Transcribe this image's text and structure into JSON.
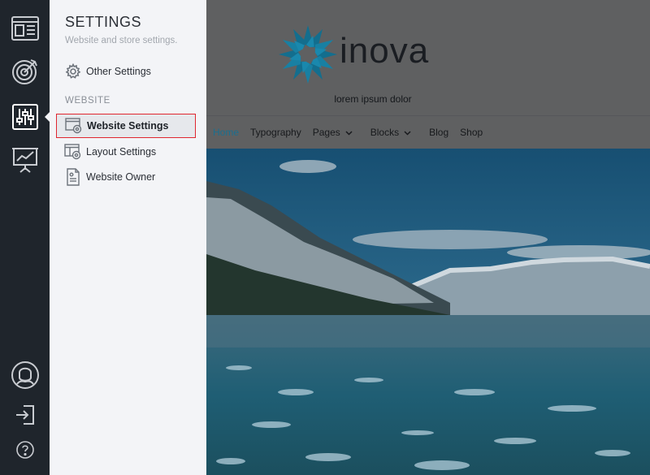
{
  "rail": {
    "items": [
      {
        "icon": "layout-icon"
      },
      {
        "icon": "target-icon"
      },
      {
        "icon": "sliders-icon",
        "active": true
      },
      {
        "icon": "presentation-chart-icon"
      },
      {
        "icon": "user-avatar-icon"
      },
      {
        "icon": "sign-in-icon"
      },
      {
        "icon": "help-icon"
      }
    ]
  },
  "panel": {
    "title": "SETTINGS",
    "subtitle": "Website and store settings.",
    "other_settings_label": "Other Settings",
    "section_heading": "WEBSITE",
    "items": [
      {
        "label": "Website Settings",
        "icon": "website-settings-icon",
        "selected": true
      },
      {
        "label": "Layout Settings",
        "icon": "layout-settings-icon"
      },
      {
        "label": "Website Owner",
        "icon": "document-icon"
      }
    ]
  },
  "site": {
    "logo_text": "inova",
    "tagline": "lorem ipsum dolor",
    "nav": [
      {
        "label": "Home",
        "active": true
      },
      {
        "label": "Typography"
      },
      {
        "label": "Pages",
        "dropdown": true
      },
      {
        "label": "Blocks",
        "dropdown": true
      },
      {
        "label": "Blog"
      },
      {
        "label": "Shop"
      }
    ]
  },
  "colors": {
    "rail_bg": "#1f252c",
    "panel_bg": "#f3f4f7",
    "selection_border": "#e0262f",
    "brand_blue": "#1c6f8f"
  }
}
